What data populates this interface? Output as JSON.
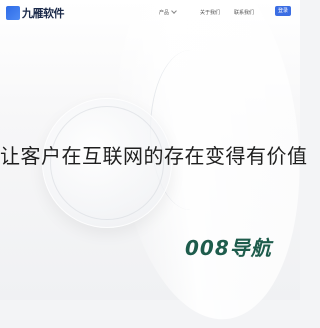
{
  "header": {
    "logo_text": "九雁软件",
    "nav": {
      "products_label": "产品",
      "about_label": "关于我们",
      "contact_label": "联系我们"
    },
    "login_label": "登录"
  },
  "hero": {
    "slogan": "让客户在互联网的存在变得有价值"
  },
  "footer_brand": {
    "text": "008导航"
  },
  "colors": {
    "accent": "#3b6de3",
    "logo": "#2e6be6",
    "brand_text": "#1e5c4c",
    "slogan_text": "#1f1f1f"
  }
}
